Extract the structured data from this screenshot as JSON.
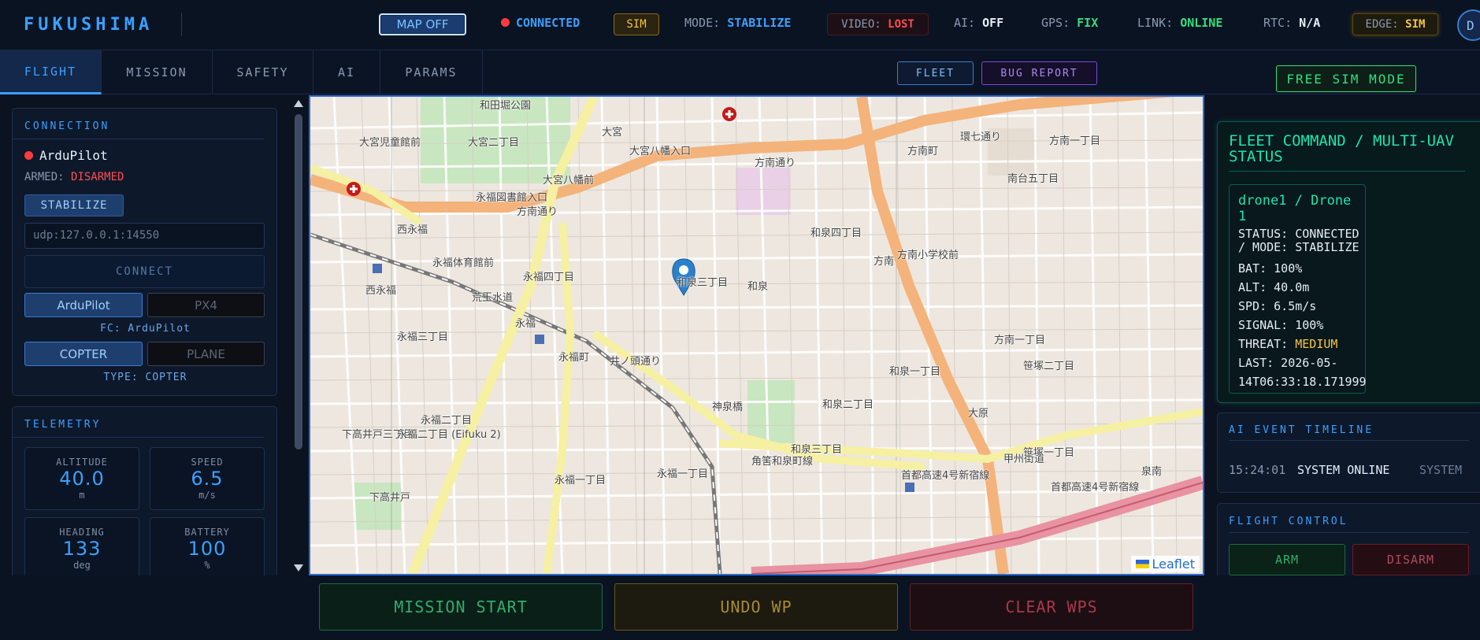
{
  "header": {
    "logo": "FUKUSHIMA",
    "map_toggle": "MAP OFF",
    "connection": "CONNECTED",
    "sim_badge": "SIM",
    "mode_label": "MODE:",
    "mode_value": "STABILIZE",
    "video_label": "VIDEO:",
    "video_value": "LOST",
    "ai_label": "AI:",
    "ai_value": "OFF",
    "gps_label": "GPS:",
    "gps_value": "FIX",
    "link_label": "LINK:",
    "link_value": "ONLINE",
    "rtc_label": "RTC:",
    "rtc_value": "N/A",
    "edge_label": "EDGE:",
    "edge_value": "SIM",
    "avatar": "D"
  },
  "tabs": [
    "FLIGHT",
    "MISSION",
    "SAFETY",
    "AI",
    "PARAMS"
  ],
  "toolbar": {
    "fleet": "FLEET",
    "bug_report": "BUG REPORT",
    "free_sim": "FREE SIM MODE"
  },
  "connection_panel": {
    "title": "CONNECTION",
    "autopilot": "ArduPilot",
    "armed_label": "ARMED:",
    "armed_value": "DISARMED",
    "mode_btn": "STABILIZE",
    "address_placeholder": "udp:127.0.0.1:14550",
    "connect_btn": "CONNECT",
    "fc_options": [
      "ArduPilot",
      "PX4"
    ],
    "fc_status": "FC: ArduPilot",
    "type_options": [
      "COPTER",
      "PLANE"
    ],
    "type_status": "TYPE: COPTER"
  },
  "telemetry": {
    "title": "TELEMETRY",
    "items": [
      {
        "label": "ALTITUDE",
        "value": "40.0",
        "unit": "m"
      },
      {
        "label": "SPEED",
        "value": "6.5",
        "unit": "m/s"
      },
      {
        "label": "HEADING",
        "value": "133",
        "unit": "deg"
      },
      {
        "label": "BATTERY",
        "value": "100",
        "unit": "%"
      }
    ]
  },
  "map": {
    "attribution": "Leaflet",
    "labels": [
      "和田堀公園",
      "大宮児童館前",
      "大宮二丁目",
      "大宮",
      "大宮八幡入口",
      "方南通り",
      "方南一丁目",
      "方南町",
      "方南通り",
      "西永福",
      "永福図書館入口",
      "大宮八幡前",
      "永福体育館前",
      "永福四丁目",
      "荒玉水道",
      "和泉四丁目",
      "方南",
      "方南小学校前",
      "西永福",
      "和泉三丁目",
      "和泉",
      "永福三丁目",
      "永福",
      "永福町",
      "井ノ頭通り",
      "和泉一丁目",
      "方南一丁目",
      "笹塚二丁目",
      "永福二丁目",
      "下高井戸三丁目",
      "永福二丁目 (Eifuku 2)",
      "神泉橋",
      "和泉二丁目",
      "和泉三丁目",
      "角筈和泉町線",
      "首都高速4号新宿線",
      "甲州街道",
      "下高井戸",
      "永福一丁目",
      "永福一丁目",
      "大原",
      "笹塚一丁目",
      "泉南",
      "首都高速4号新宿線",
      "南台五丁目",
      "環七通り"
    ]
  },
  "fleet": {
    "title": "FLEET COMMAND / MULTI-UAV STATUS",
    "drone_name": "drone1 / Drone 1",
    "status_line1": "STATUS: CONNECTED",
    "status_line2": "/ MODE: STABILIZE",
    "bat": "BAT: 100%",
    "alt": "ALT: 40.0m",
    "spd": "SPD: 6.5m/s",
    "signal": "SIGNAL: 100%",
    "threat_label": "THREAT:",
    "threat_value": "MEDIUM",
    "last_line1": "LAST: 2026-05-",
    "last_line2": "14T06:33:18.171999"
  },
  "timeline": {
    "title": "AI EVENT TIMELINE",
    "time": "15:24:01",
    "event": "SYSTEM ONLINE",
    "source": "SYSTEM"
  },
  "flight_control": {
    "title": "FLIGHT CONTROL",
    "arm": "ARM",
    "disarm": "DISARM"
  },
  "bottom": {
    "mission_start": "MISSION START",
    "undo_wp": "UNDO WP",
    "clear_wps": "CLEAR WPS"
  },
  "colors": {
    "accent": "#3aa0ff",
    "success": "#2fe07a",
    "danger": "#ff4d4d",
    "warning": "#f5c542",
    "fleet": "#19e6b0"
  }
}
